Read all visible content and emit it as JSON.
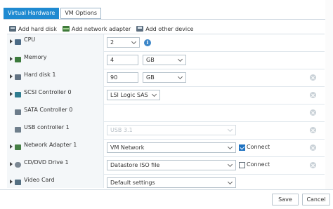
{
  "tabs": [
    {
      "label": "Virtual Hardware",
      "active": true
    },
    {
      "label": "VM Options",
      "active": false
    }
  ],
  "toolbar": {
    "add_hard_disk": "Add hard disk",
    "add_network_adapter": "Add network adapter",
    "add_other_device": "Add other device"
  },
  "devices": {
    "cpu": {
      "label": "CPU",
      "value": "2"
    },
    "memory": {
      "label": "Memory",
      "value": "4",
      "unit": "GB"
    },
    "hard_disk": {
      "label": "Hard disk 1",
      "value": "90",
      "unit": "GB"
    },
    "scsi": {
      "label": "SCSI Controller 0",
      "value": "LSI Logic SAS"
    },
    "sata": {
      "label": "SATA Controller 0"
    },
    "usb": {
      "label": "USB controller 1",
      "value": "USB 3.1"
    },
    "network": {
      "label": "Network Adapter 1",
      "value": "VM Network",
      "connect_label": "Connect",
      "connected": true
    },
    "cdrom": {
      "label": "CD/DVD Drive 1",
      "value": "Datastore ISO file",
      "connect_label": "Connect",
      "connected": false
    },
    "video": {
      "label": "Video Card",
      "value": "Default settings"
    }
  },
  "footer": {
    "save_label": "Save",
    "cancel_label": "Cancel"
  },
  "colors": {
    "accent": "#1f8ad1",
    "checkbox_on": "#1f73c2"
  }
}
